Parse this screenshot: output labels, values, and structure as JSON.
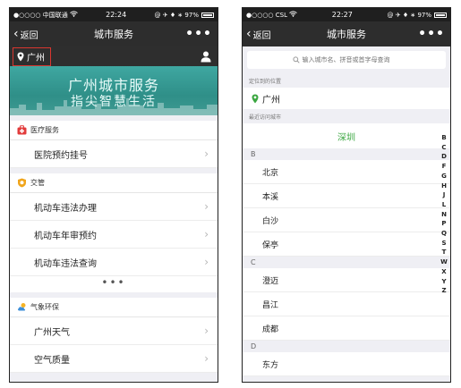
{
  "left": {
    "status": {
      "carrier": "●○○○○ 中国联通",
      "wifi": "wifi-icon",
      "time": "22:24",
      "right": "@ ✈ ♦ ∗ 97%"
    },
    "nav": {
      "back_label": "返回",
      "title": "城市服务",
      "more": "•••"
    },
    "location": {
      "city": "广州"
    },
    "banner": {
      "line1": "广州城市服务",
      "line2": "指尖智慧生活"
    },
    "sections": [
      {
        "title": "医疗服务",
        "icon": "medical-kit-icon",
        "items": [
          "医院预约挂号"
        ]
      },
      {
        "title": "交管",
        "icon": "traffic-shield-icon",
        "items": [
          "机动车违法办理",
          "机动车年审预约",
          "机动车违法查询"
        ],
        "more": "•••"
      },
      {
        "title": "气象环保",
        "icon": "weather-cloud-icon",
        "items": [
          "广州天气",
          "空气质量"
        ]
      }
    ],
    "chevron": "›"
  },
  "right": {
    "status": {
      "carrier": "●○○○○ CSL",
      "wifi": "wifi-icon",
      "time": "22:27",
      "right": "@ ✈ ♦ ∗ 97%"
    },
    "nav": {
      "back_label": "返回",
      "title": "城市服务",
      "more": "•••"
    },
    "search": {
      "placeholder": "输入城市名、拼音或首字母查询"
    },
    "current_label": "定位到的位置",
    "current_city": "广州",
    "recent_label": "最近访问城市",
    "recent_city": "深圳",
    "groups": [
      {
        "letter": "B",
        "cities": [
          "北京",
          "本溪",
          "白沙",
          "保亭"
        ]
      },
      {
        "letter": "C",
        "cities": [
          "澄迈",
          "昌江",
          "成都"
        ]
      },
      {
        "letter": "D",
        "cities": [
          "东方"
        ]
      }
    ],
    "index_letters": [
      "B",
      "C",
      "D",
      "F",
      "G",
      "H",
      "J",
      "L",
      "N",
      "P",
      "Q",
      "S",
      "T",
      "W",
      "X",
      "Y",
      "Z"
    ],
    "colors": {
      "green": "#3aa640",
      "red_highlight": "#d9362f"
    }
  }
}
